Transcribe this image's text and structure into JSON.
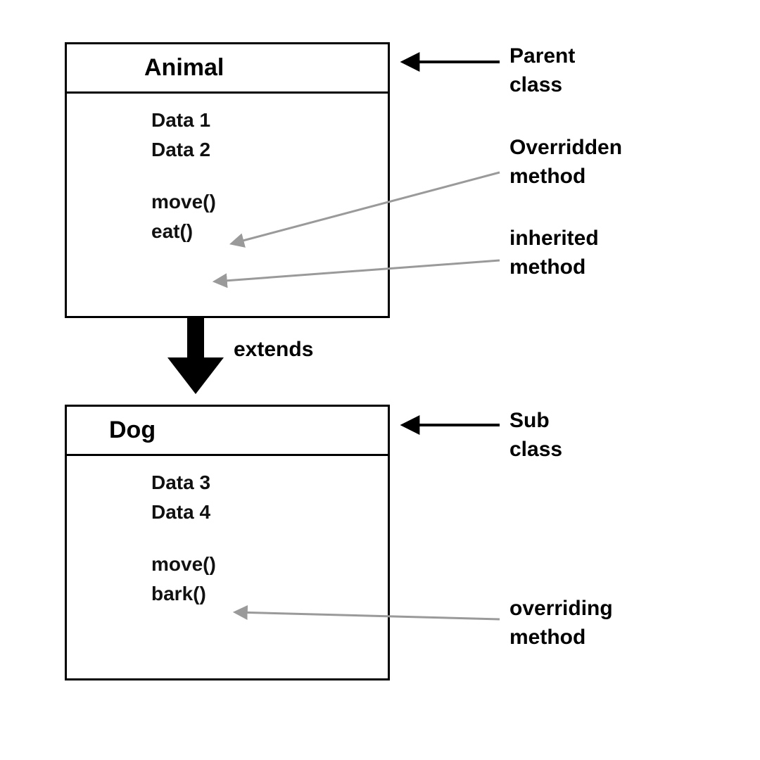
{
  "parent": {
    "title": "Animal",
    "data1": "Data 1",
    "data2": "Data 2",
    "method1": "move()",
    "method2": "eat()"
  },
  "child": {
    "title": "Dog",
    "data1": "Data 3",
    "data2": "Data 4",
    "method1": "move()",
    "method2": "bark()"
  },
  "labels": {
    "parent_line1": "Parent",
    "parent_line2": "class",
    "overridden_line1": "Overridden",
    "overridden_line2": "method",
    "inherited_line1": "inherited",
    "inherited_line2": "method",
    "sub_line1": "Sub",
    "sub_line2": "class",
    "overriding_line1": "overriding",
    "overriding_line2": "method",
    "extends": "extends"
  }
}
